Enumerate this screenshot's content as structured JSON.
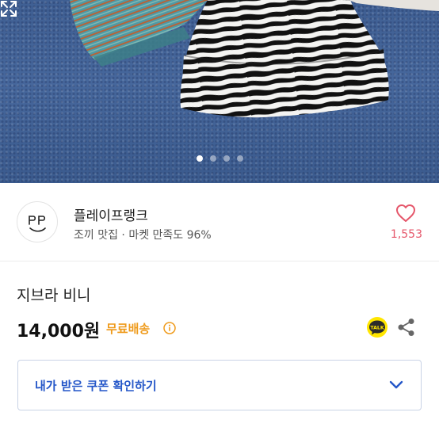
{
  "gallery": {
    "image_icon": "product-photo",
    "page_count": 4,
    "active_page": 1,
    "expand_icon": "expand-icon"
  },
  "seller": {
    "avatar_icon": "smiley-pp-logo",
    "name": "플레이프랭크",
    "subtitle": "조끼 맛집 · 마켓 만족도 96%",
    "like_count": "1,553"
  },
  "product": {
    "title": "지브라 비니",
    "price": "14,000원",
    "shipping": "무료배송"
  },
  "actions": {
    "talk_label": "TALK",
    "share_icon": "share-icon"
  },
  "coupon": {
    "label": "내가 받은 쿠폰 확인하기"
  },
  "colors": {
    "like": "#e5566a",
    "shipping": "#ef9b1c",
    "coupon_text": "#2456c8",
    "talk_bg": "#2b2b2b",
    "talk_yellow": "#ffe600"
  }
}
